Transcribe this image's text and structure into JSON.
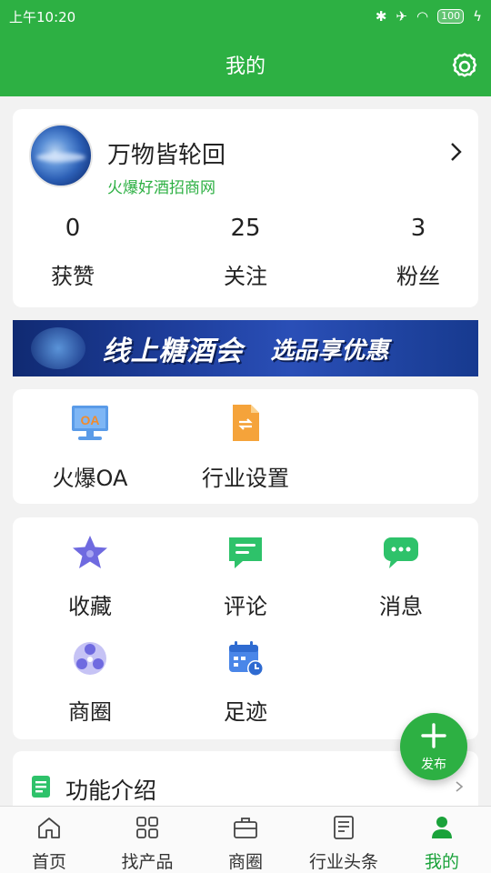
{
  "status_bar": {
    "time": "上午10:20",
    "battery": "100"
  },
  "header": {
    "title": "我的"
  },
  "profile": {
    "name": "万物皆轮回",
    "subtitle": "火爆好酒招商网",
    "stats": [
      {
        "count": "0",
        "label": "获赞"
      },
      {
        "count": "25",
        "label": "关注"
      },
      {
        "count": "3",
        "label": "粉丝"
      }
    ]
  },
  "banner": {
    "text_main": "线上糖酒会",
    "text_sub": "选品享优惠"
  },
  "tools": [
    {
      "label": "火爆OA",
      "icon": "oa-monitor-icon"
    },
    {
      "label": "行业设置",
      "icon": "document-exchange-icon"
    }
  ],
  "features": [
    {
      "label": "收藏",
      "icon": "star-icon"
    },
    {
      "label": "评论",
      "icon": "comment-icon"
    },
    {
      "label": "消息",
      "icon": "message-icon"
    },
    {
      "label": "商圈",
      "icon": "business-circle-icon"
    },
    {
      "label": "足迹",
      "icon": "calendar-clock-icon"
    }
  ],
  "intro": {
    "label": "功能介绍"
  },
  "fab": {
    "label": "发布"
  },
  "tabs": [
    {
      "label": "首页",
      "icon": "home-icon",
      "active": false
    },
    {
      "label": "找产品",
      "icon": "grid-icon",
      "active": false
    },
    {
      "label": "商圈",
      "icon": "briefcase-icon",
      "active": false
    },
    {
      "label": "行业头条",
      "icon": "news-icon",
      "active": false
    },
    {
      "label": "我的",
      "icon": "person-icon",
      "active": true
    }
  ],
  "colors": {
    "brand": "#2db043",
    "tab_active": "#1aa23a"
  }
}
